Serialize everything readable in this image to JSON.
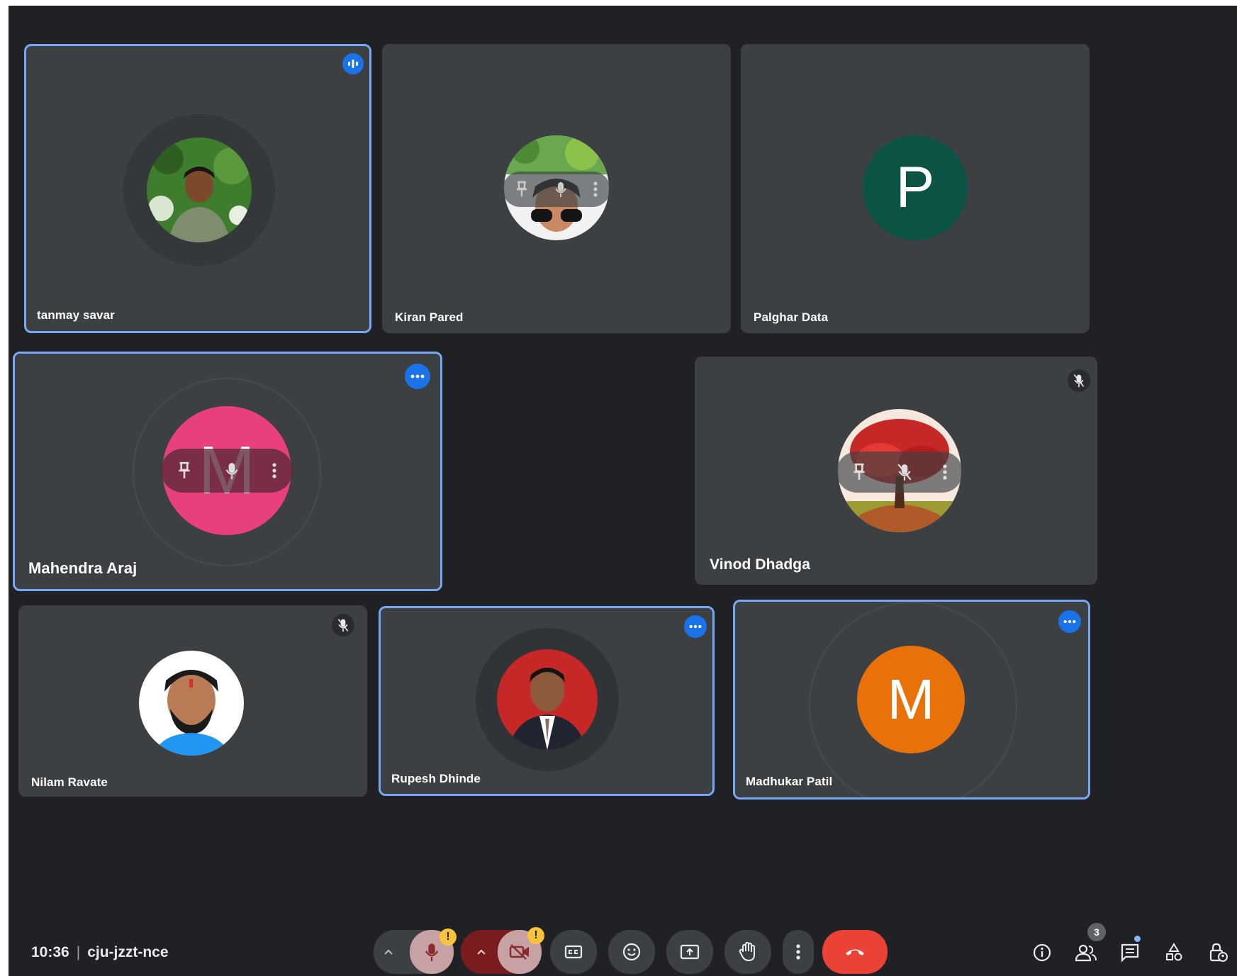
{
  "participants": [
    {
      "name": "tanmay savar",
      "avatar": "photo",
      "state": "speaking"
    },
    {
      "name": "Kiran Pared",
      "avatar": "photo",
      "state": "hover-controls"
    },
    {
      "name": "Palghar Data",
      "avatar": "letter",
      "letter": "P",
      "color": "#0b5345"
    },
    {
      "name": "Mahendra Araj",
      "avatar": "letter",
      "letter": "M",
      "color": "#e8407c",
      "state": "more-options"
    },
    {
      "name": "Vinod Dhadga",
      "avatar": "photo",
      "state": "muted"
    },
    {
      "name": "Nilam Ravate",
      "avatar": "photo",
      "state": "muted"
    },
    {
      "name": "Rupesh Dhinde",
      "avatar": "photo",
      "state": "more-options"
    },
    {
      "name": "Madhukar Patil",
      "avatar": "letter",
      "letter": "M",
      "color": "#e8710a",
      "state": "more-options"
    }
  ],
  "bottom_bar": {
    "time": "10:36",
    "meeting_code": "cju-jzzt-nce",
    "participant_count": "3",
    "warning_mark": "!"
  },
  "colors": {
    "active_border": "#7aa7f5",
    "tile_bg": "#3c4043",
    "end_call": "#ea4335",
    "accent_blue": "#1a73e8"
  }
}
